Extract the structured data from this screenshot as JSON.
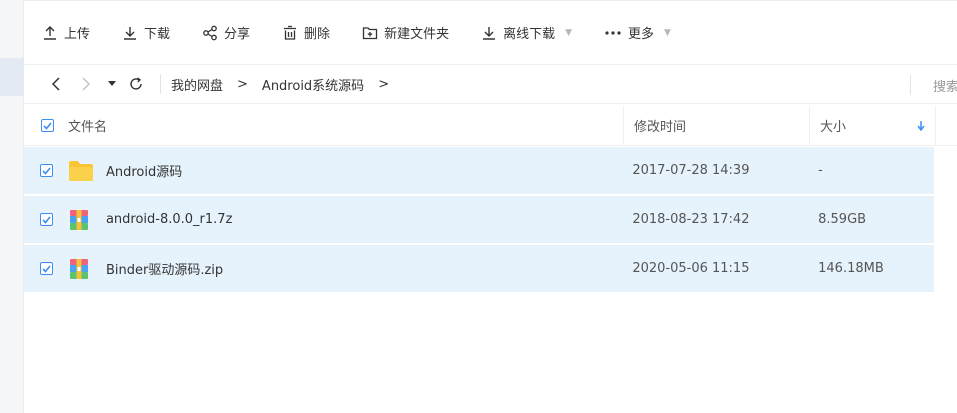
{
  "toolbar": {
    "upload": "上传",
    "download": "下载",
    "share": "分享",
    "delete": "删除",
    "new_folder": "新建文件夹",
    "offline_download": "离线下载",
    "more": "更多"
  },
  "path": {
    "root": "我的网盘",
    "folder": "Android系统源码",
    "separator": ">",
    "search_placeholder": "搜索"
  },
  "table": {
    "headers": {
      "name": "文件名",
      "modified": "修改时间",
      "size": "大小"
    },
    "rows": [
      {
        "name": "Android源码",
        "modified": "2017-07-28 14:39",
        "size": "-",
        "type": "folder",
        "checked": true
      },
      {
        "name": "android-8.0.0_r1.7z",
        "modified": "2018-08-23 17:42",
        "size": "8.59GB",
        "type": "archive",
        "checked": true
      },
      {
        "name": "Binder驱动源码.zip",
        "modified": "2020-05-06 11:15",
        "size": "146.18MB",
        "type": "archive",
        "checked": true
      }
    ]
  },
  "colors": {
    "accent": "#3b8ff0",
    "selected_row": "#e6f3fc",
    "folder": "#f9c535"
  },
  "icons": [
    "upload-icon",
    "download-icon",
    "share-icon",
    "delete-icon",
    "new-folder-icon",
    "offline-download-icon",
    "more-icon",
    "back-icon",
    "forward-icon",
    "refresh-icon",
    "sort-desc-icon",
    "folder-icon",
    "archive-icon"
  ]
}
